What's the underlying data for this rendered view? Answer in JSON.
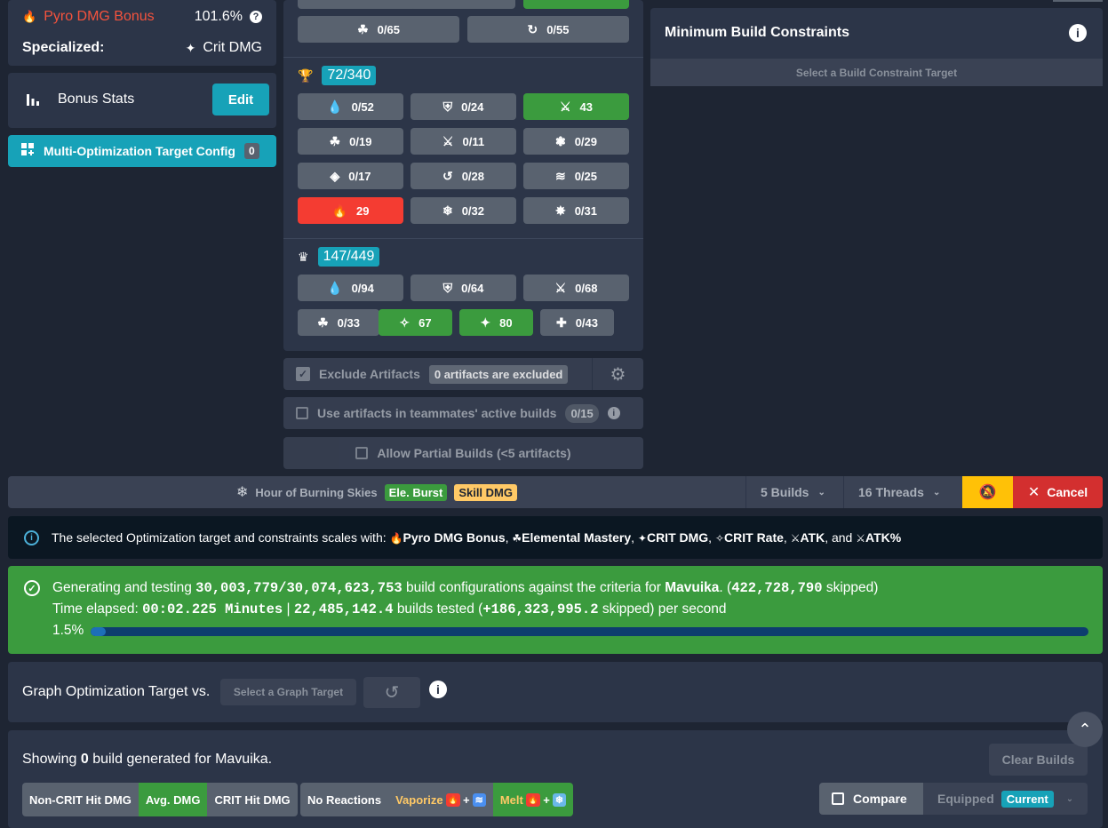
{
  "left_panel": {
    "pyro_dmg_label": "Pyro DMG Bonus",
    "pyro_dmg_value": "101.6%",
    "specialized_label": "Specialized:",
    "specialized_value": "Crit DMG",
    "bonus_stats_label": "Bonus Stats",
    "edit_label": "Edit",
    "multi_opt_label": "Multi-Optimization Target Config",
    "multi_opt_count": "0"
  },
  "sands_row": [
    {
      "icon": "elemental-mastery-icon",
      "value": "0/65"
    },
    {
      "icon": "energy-recharge-icon",
      "value": "0/55"
    }
  ],
  "goblet": {
    "count": "72/340",
    "buttons": [
      {
        "icon": "hp-icon",
        "value": "0/52",
        "state": "default"
      },
      {
        "icon": "def-icon",
        "value": "0/24",
        "state": "default"
      },
      {
        "icon": "atk-icon",
        "value": "43",
        "state": "green"
      },
      {
        "icon": "elemental-mastery-icon",
        "value": "0/19",
        "state": "default"
      },
      {
        "icon": "physical-icon",
        "value": "0/11",
        "state": "default"
      },
      {
        "icon": "anemo-icon",
        "value": "0/29",
        "state": "default"
      },
      {
        "icon": "geo-icon",
        "value": "0/17",
        "state": "default"
      },
      {
        "icon": "dendro-icon",
        "value": "0/28",
        "state": "default"
      },
      {
        "icon": "hydro-icon",
        "value": "0/25",
        "state": "default"
      },
      {
        "icon": "pyro-icon",
        "value": "29",
        "state": "red"
      },
      {
        "icon": "cryo-icon",
        "value": "0/32",
        "state": "default"
      },
      {
        "icon": "electro-icon",
        "value": "0/31",
        "state": "default"
      }
    ]
  },
  "circlet": {
    "count": "147/449",
    "row1": [
      {
        "icon": "hp-icon",
        "value": "0/94",
        "state": "default"
      },
      {
        "icon": "def-icon",
        "value": "0/64",
        "state": "default"
      },
      {
        "icon": "atk-icon",
        "value": "0/68",
        "state": "default"
      }
    ],
    "row2": [
      {
        "icon": "elemental-mastery-icon",
        "value": "0/33",
        "state": "default"
      },
      {
        "icon": "crit-rate-icon",
        "value": "67",
        "state": "green"
      },
      {
        "icon": "crit-dmg-icon",
        "value": "80",
        "state": "green"
      },
      {
        "icon": "heal-icon",
        "value": "0/43",
        "state": "default"
      }
    ]
  },
  "exclude": {
    "label": "Exclude Artifacts",
    "badge": "0 artifacts are excluded"
  },
  "teammates": {
    "label": "Use artifacts in teammates' active builds",
    "count": "0/15"
  },
  "partial": {
    "label": "Allow Partial Builds (<5 artifacts)"
  },
  "constraints": {
    "title": "Minimum Build Constraints",
    "select_label": "Select a Build Constraint Target"
  },
  "toolbar": {
    "target_name": "Hour of Burning Skies",
    "tag1": "Ele. Burst",
    "tag2": "Skill DMG",
    "builds": "5 Builds",
    "threads": "16 Threads",
    "cancel": "Cancel"
  },
  "info": {
    "prefix": "The selected Optimization target and constraints scales with:",
    "stats": [
      "Pyro DMG Bonus",
      "Elemental Mastery",
      "CRIT DMG",
      "CRIT Rate",
      "ATK",
      "ATK%"
    ],
    "sep": ",",
    "and": ", and"
  },
  "progress": {
    "line1_a": "Generating and testing",
    "tested": "30,003,779/30,074,623,753",
    "line1_b": "build configurations against the criteria for",
    "character": "Mavuika",
    "skipped": "422,728,790",
    "skipped_word": "skipped)",
    "time_label": "Time elapsed:",
    "time_value": "00:02.225 Minutes",
    "rate": "22,485,142.4",
    "rate_text": "builds tested (",
    "skip_rate": "+186,323,995.2",
    "skip_rate_text": "skipped) per second",
    "percent_label": "1.5%",
    "percent": 1.5,
    "bar_color": "#1d6fb8"
  },
  "graph": {
    "label": "Graph Optimization Target vs.",
    "select_label": "Select a Graph Target"
  },
  "results": {
    "showing_a": "Showing",
    "count": "0",
    "showing_b": "build generated for Mavuika.",
    "clear": "Clear Builds",
    "modes": [
      "Non-CRIT Hit DMG",
      "Avg. DMG",
      "CRIT Hit DMG"
    ],
    "no_reactions": "No Reactions",
    "vaporize": "Vaporize",
    "melt": "Melt",
    "plus": "+",
    "compare": "Compare",
    "equipped": "Equipped",
    "current": "Current"
  },
  "colors": {
    "green": "#3b9b3e",
    "red": "#f43c32",
    "teal": "#17a2b8",
    "yellow": "#ffc107",
    "cancel": "#d32f2f"
  }
}
